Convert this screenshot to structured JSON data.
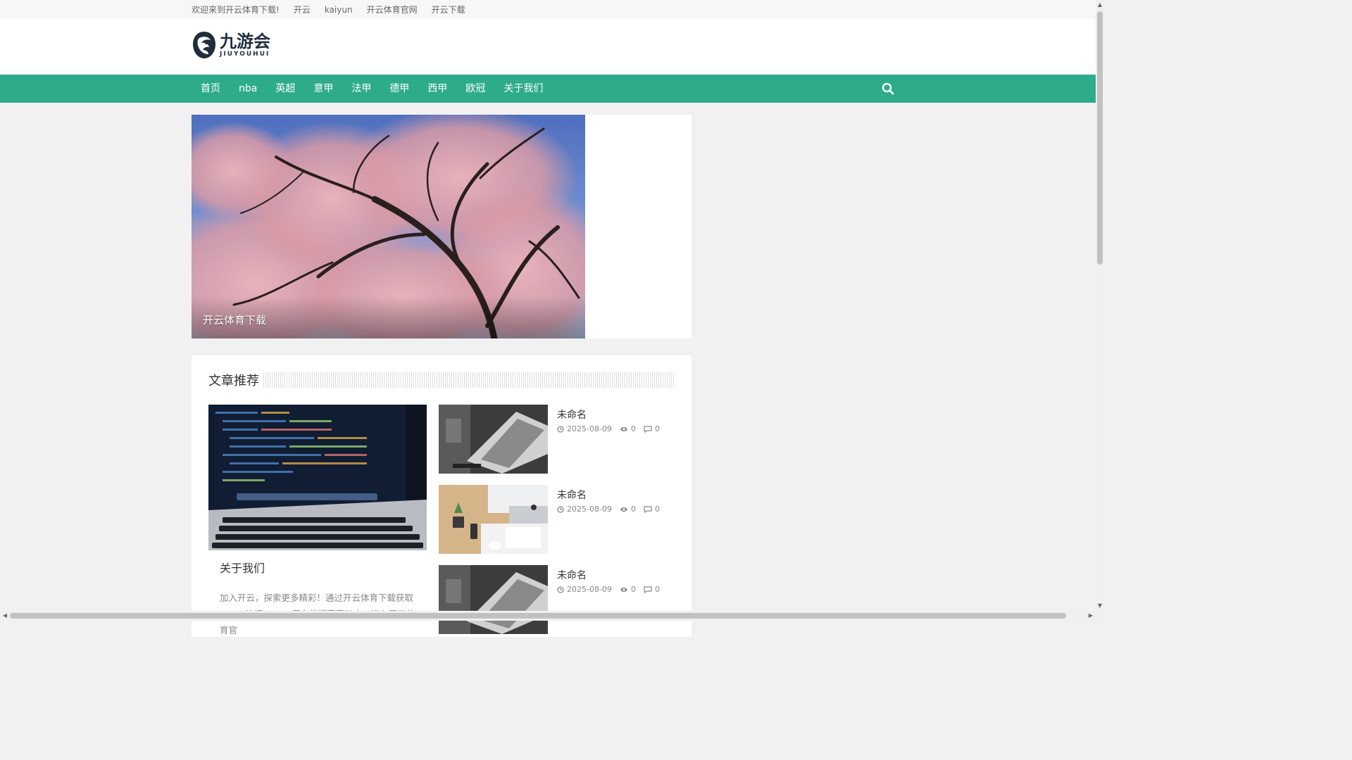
{
  "topbar": {
    "welcome": "欢迎来到开云体育下载!",
    "links": [
      "开云",
      "kaiyun",
      "开云体育官网",
      "开云下载"
    ]
  },
  "logo": {
    "cn": "九游会",
    "en": "JIUYOUHUI"
  },
  "nav": {
    "items": [
      "首页",
      "nba",
      "英超",
      "意甲",
      "法甲",
      "德甲",
      "西甲",
      "欧冠",
      "关于我们"
    ],
    "search_icon": "search-icon"
  },
  "slider": {
    "caption": "开云体育下载"
  },
  "articles": {
    "section_title": "文章推荐",
    "feature": {
      "title": "关于我们",
      "desc": "加入开云，探索更多精彩！通过开云体育下载获取APP，访问kaiyun平台掌握赛事动态，进入开云体育官"
    },
    "list": [
      {
        "title": "未命名",
        "date": "2025-08-09",
        "views": "0",
        "comments": "0"
      },
      {
        "title": "未命名",
        "date": "2025-08-09",
        "views": "0",
        "comments": "0"
      },
      {
        "title": "未命名",
        "date": "2025-08-09",
        "views": "0",
        "comments": "0"
      }
    ]
  },
  "colors": {
    "accent": "#2eab8b",
    "topbar_bg": "#f6f8f7",
    "page_bg": "#f1f1f1"
  }
}
